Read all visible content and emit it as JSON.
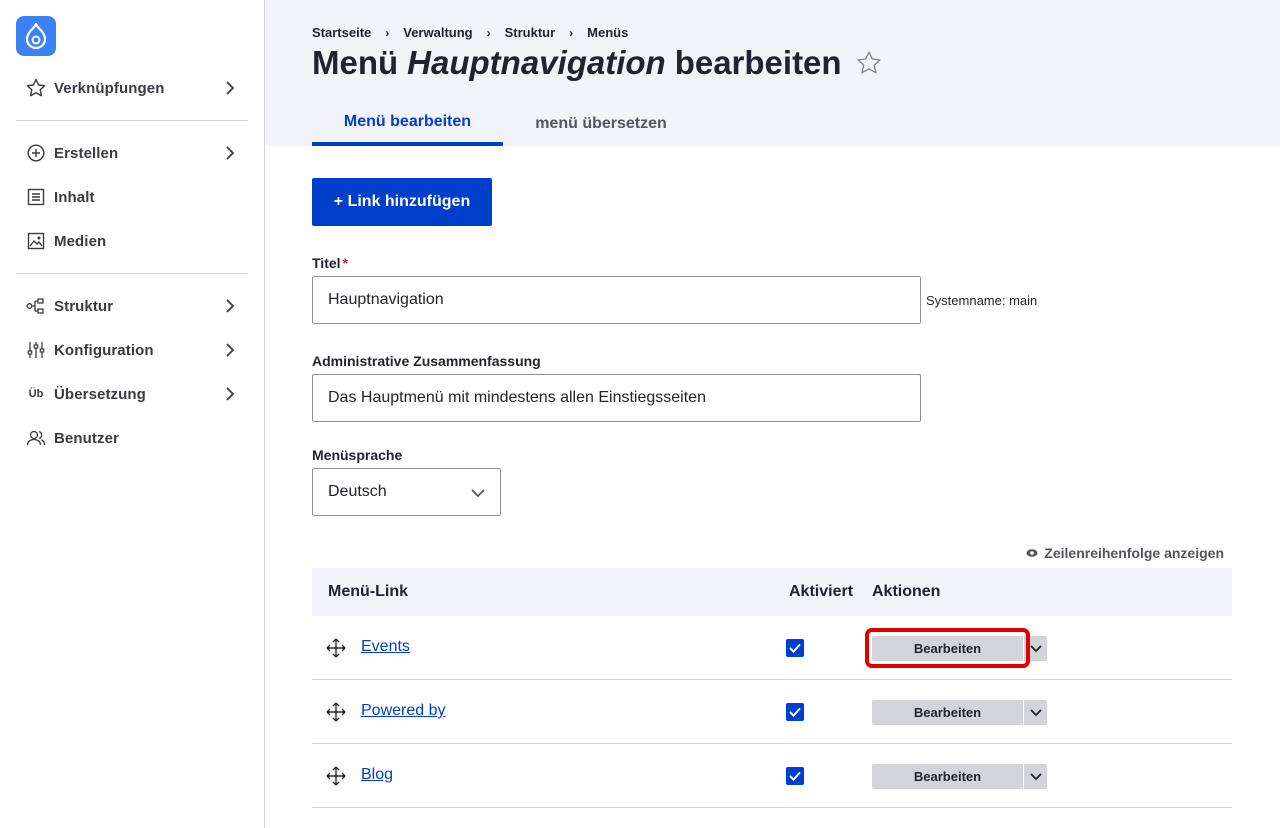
{
  "sidebar": {
    "items": [
      {
        "label": "Verknüpfungen",
        "icon": "star-icon"
      },
      {
        "label": "Erstellen",
        "icon": "plus-circle-icon"
      },
      {
        "label": "Inhalt",
        "icon": "document-icon"
      },
      {
        "label": "Medien",
        "icon": "image-icon"
      },
      {
        "label": "Struktur",
        "icon": "sitemap-icon"
      },
      {
        "label": "Konfiguration",
        "icon": "sliders-icon"
      },
      {
        "label": "Übersetzung",
        "icon_text": "Üb"
      },
      {
        "label": "Benutzer",
        "icon": "users-icon"
      }
    ]
  },
  "breadcrumb": [
    "Startseite",
    "Verwaltung",
    "Struktur",
    "Menüs"
  ],
  "title": {
    "prefix": "Menü",
    "name": "Hauptnavigation",
    "suffix": "bearbeiten"
  },
  "tabs": [
    {
      "label": "Menü bearbeiten",
      "active": true
    },
    {
      "label": "menü übersetzen",
      "active": false
    }
  ],
  "add_link_label": "+ Link hinzufügen",
  "form": {
    "title_label": "Titel",
    "title_required": "*",
    "title_value": "Hauptnavigation",
    "system_name": "Systemname: main",
    "summary_label": "Administrative Zusammenfassung",
    "summary_value": "Das Hauptmenü mit mindestens allen Einstiegsseiten",
    "language_label": "Menüsprache",
    "language_value": "Deutsch"
  },
  "row_order_label": "Zeilenreihenfolge anzeigen",
  "table": {
    "headers": [
      "Menü-Link",
      "Aktiviert",
      "Aktionen"
    ],
    "rows": [
      {
        "link": "Events",
        "enabled": true,
        "action": "Bearbeiten"
      },
      {
        "link": "Powered by",
        "enabled": true,
        "action": "Bearbeiten"
      },
      {
        "link": "Blog",
        "enabled": true,
        "action": "Bearbeiten"
      }
    ]
  },
  "colors": {
    "accent": "#003ecc",
    "logo": "#3b82f6",
    "highlight": "#e00000"
  }
}
